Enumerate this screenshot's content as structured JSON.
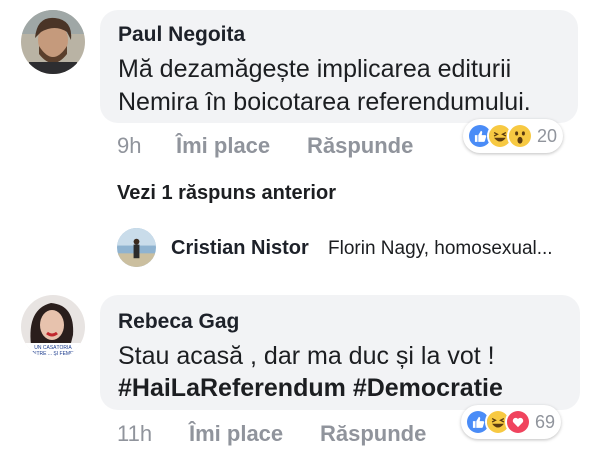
{
  "comments": [
    {
      "author": "Paul Negoita",
      "lines": [
        "Mă dezamăgește implicarea editurii",
        "Nemira în boicotarea referendumului."
      ],
      "time": "9h",
      "like_label": "Îmi place",
      "reply_label": "Răspunde",
      "reactions": [
        "like-icon",
        "haha-icon",
        "wow-icon"
      ],
      "reaction_count": "20"
    },
    {
      "author": "Rebeca Gag",
      "line1": "Stau acasă , dar ma duc și la vot !",
      "hashtag1": "#HaiLaReferendum",
      "hashtag2": "#Democratie",
      "avatar_caption": "UN CĂSĂTORIA DINTRE ... ȘI FEMEIE",
      "time": "11h",
      "like_label": "Îmi place",
      "reply_label": "Răspunde",
      "reactions": [
        "like-icon",
        "haha-icon",
        "love-icon"
      ],
      "reaction_count": "69"
    }
  ],
  "replies": {
    "see_previous": "Vezi 1 răspuns anterior",
    "author": "Cristian Nistor",
    "preview": "Florin Nagy, homosexual..."
  },
  "colors": {
    "bubble": "#f2f3f5",
    "meta": "#90949c",
    "like": "#4a8cf7",
    "haha": "#f7c942",
    "love": "#f0445e"
  }
}
